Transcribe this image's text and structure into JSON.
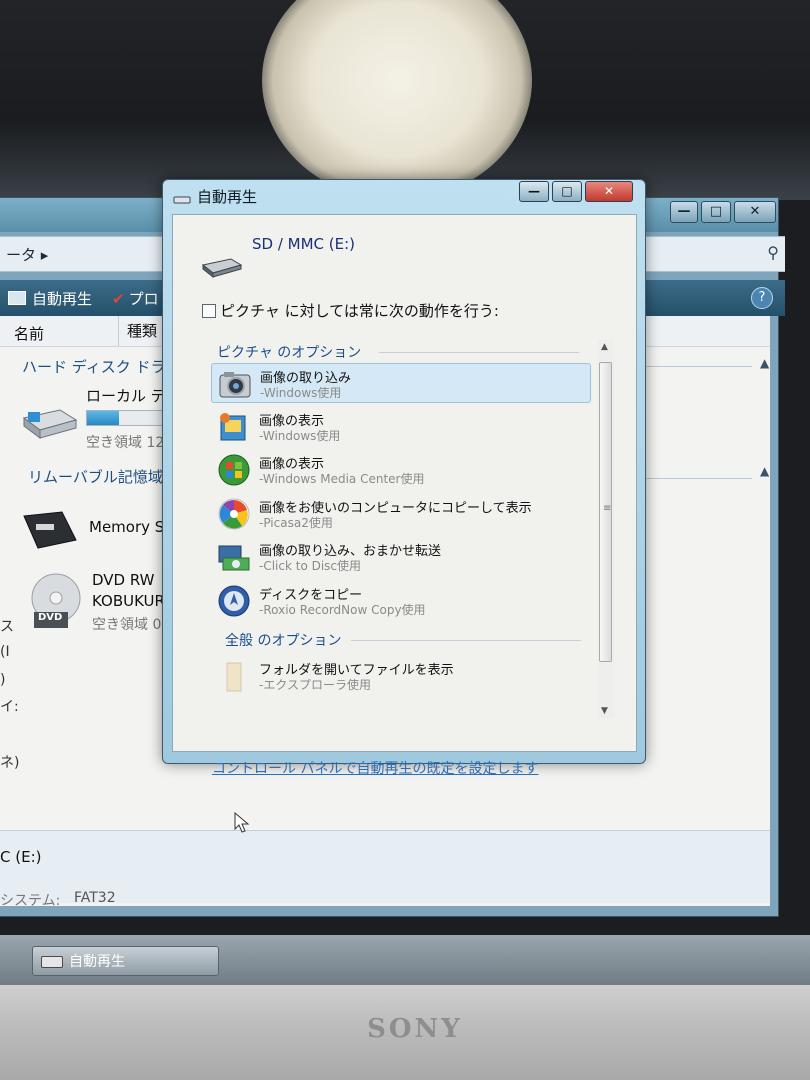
{
  "screen": {
    "brand": "SONY"
  },
  "explorer": {
    "address_fragment": "ータ",
    "toolbar": {
      "autoplay_label": "自動再生",
      "properties_label": "プロ"
    },
    "columns": {
      "name": "名前",
      "type": "種類"
    },
    "groups": {
      "hard_disk": "ハード ディスク ドラ",
      "removable": "リムーバブル記憶域"
    },
    "drives": {
      "local_label": "ローカル デ",
      "local_free": "空き領域 12",
      "memory_stick_label": "Memory St",
      "dvd_label": "DVD RW ド",
      "dvd_volume": "KOBUKURO",
      "dvd_free": "空き領域 0",
      "dvd_badge": "DVD"
    },
    "left_fragments": [
      "ス",
      "(I",
      ")",
      "イ:",
      "ネ)"
    ],
    "details": {
      "drive_text": "C (E:)",
      "filesystem_label": "システム:",
      "filesystem_value": "FAT32"
    }
  },
  "taskbar": {
    "task_label": "自動再生"
  },
  "dialog": {
    "title": "自動再生",
    "device_name": "SD / MMC (E:)",
    "always_do_label": "ピクチャ に対しては常に次の動作を行う:",
    "always_do_checked": false,
    "picture_section_title": "ピクチャ のオプション",
    "options": [
      {
        "title": "画像の取り込み",
        "subtitle": "-Windows使用",
        "icon": "camera-icon",
        "selected": true
      },
      {
        "title": "画像の表示",
        "subtitle": "-Windows使用",
        "icon": "photo-gallery-icon",
        "selected": false
      },
      {
        "title": "画像の表示",
        "subtitle": "-Windows Media Center使用",
        "icon": "windows-media-center-icon",
        "selected": false
      },
      {
        "title": "画像をお使いのコンピュータにコピーして表示",
        "subtitle": "-Picasa2使用",
        "icon": "picasa-icon",
        "selected": false
      },
      {
        "title": "画像の取り込み、おまかせ転送",
        "subtitle": "-Click to Disc使用",
        "icon": "click-to-disc-icon",
        "selected": false
      },
      {
        "title": "ディスクをコピー",
        "subtitle": "-Roxio RecordNow Copy使用",
        "icon": "roxio-disc-icon",
        "selected": false
      }
    ],
    "general_section_title": "全般 のオプション",
    "general_options": [
      {
        "title": "フォルダを開いてファイルを表示",
        "subtitle": "-エクスプローラ使用",
        "icon": "folder-icon"
      }
    ],
    "control_panel_link": "コントロール パネルで自動再生の既定を設定します",
    "colors": {
      "link": "#2c6fb6",
      "section": "#1a4f8f",
      "close_button": "#c9463d"
    }
  }
}
